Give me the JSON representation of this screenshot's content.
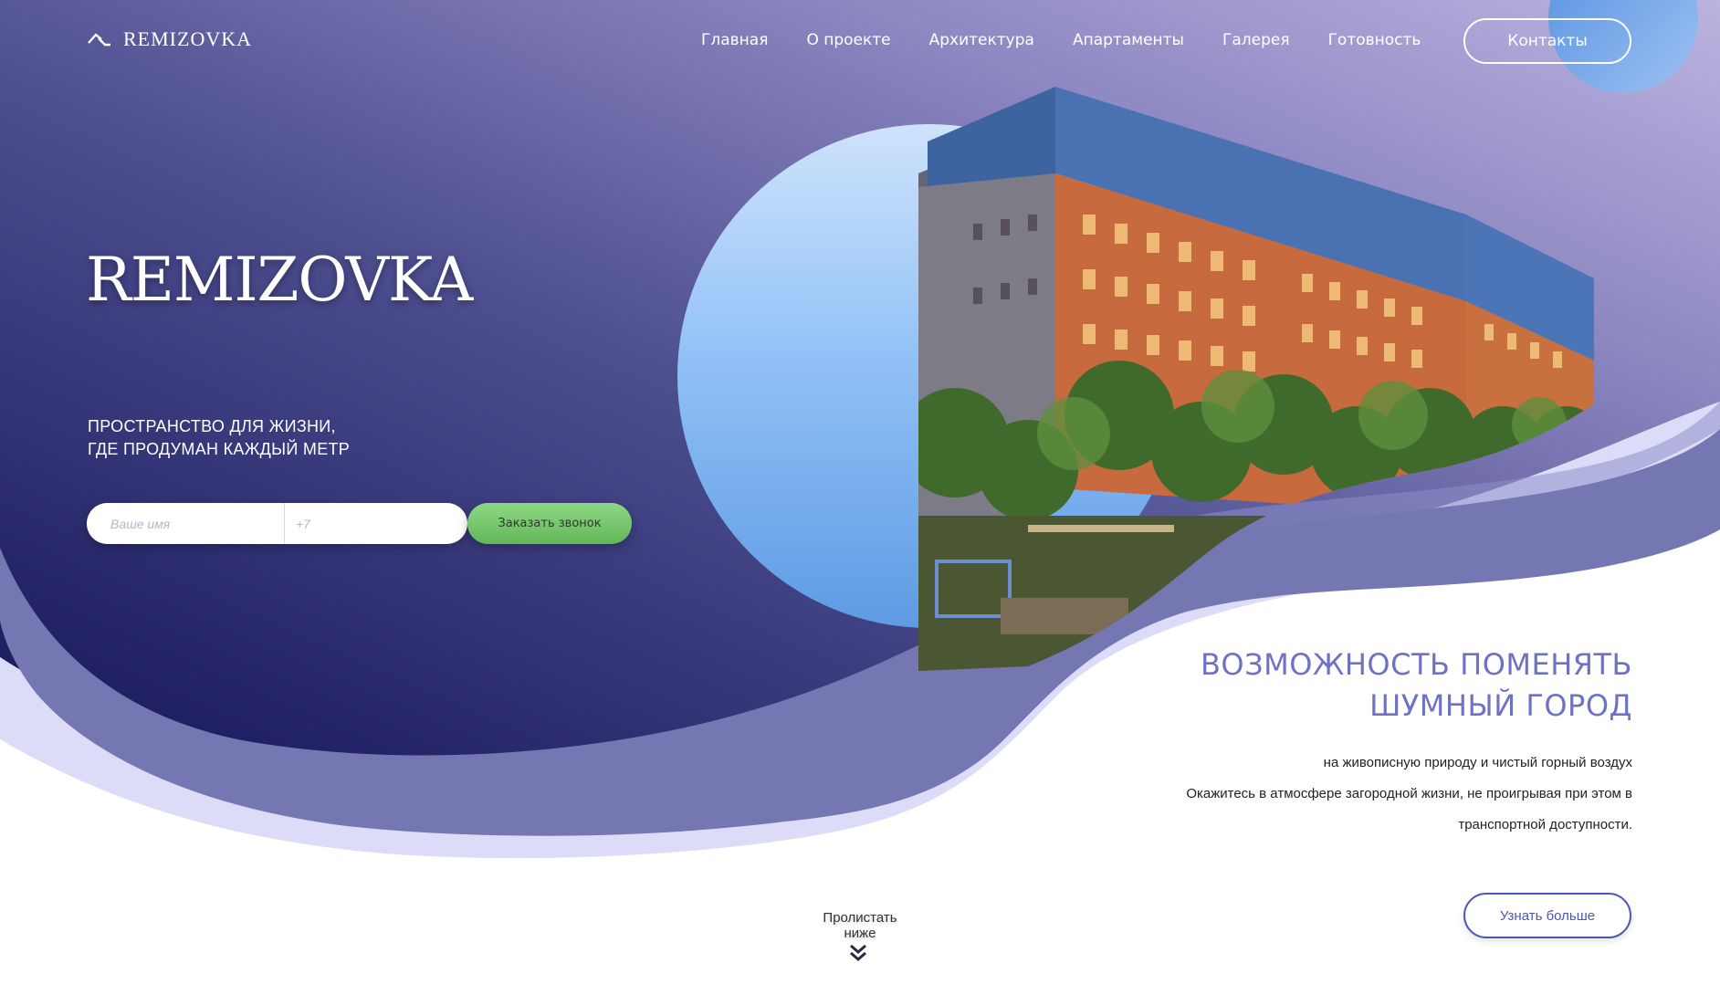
{
  "header": {
    "logo_text": "REMIZOVKA",
    "nav": [
      {
        "label": "Главная"
      },
      {
        "label": "О проекте"
      },
      {
        "label": "Архитектура"
      },
      {
        "label": "Апартаменты"
      },
      {
        "label": "Галерея"
      },
      {
        "label": "Готовность"
      }
    ],
    "contacts_label": "Контакты"
  },
  "hero": {
    "title": "REMIZOVKA",
    "subtitle_line1": "ПРОСТРАНСТВО ДЛЯ ЖИЗНИ,",
    "subtitle_line2": "ГДЕ ПРОДУМАН КАЖДЫЙ МЕТР",
    "form": {
      "name_placeholder": "Ваше имя",
      "phone_placeholder": "+7",
      "submit_label": "Заказать звонок"
    }
  },
  "feature": {
    "title_line1": "ВОЗМОЖНОСТЬ ПОМЕНЯТЬ",
    "title_line2": "ШУМНЫЙ ГОРОД",
    "text_line1": "на живописную природу и чистый горный воздух",
    "text_line2": "Окажитесь в атмосфере загородной жизни, не проигрывая при этом в",
    "text_line3": "транспортной доступности.",
    "more_label": "Узнать больше"
  },
  "scroll": {
    "label": "Пролистать ниже",
    "icon": "double-chevron-down-icon"
  },
  "colors": {
    "hero_dark": "#1a1a5e",
    "hero_light": "#b2a9d9",
    "wave_mid": "#7477b2",
    "wave_light": "#dddcf8",
    "accent_title": "#6e72c4",
    "button_green": "#6cc063",
    "button_outline": "#4f55b5"
  }
}
